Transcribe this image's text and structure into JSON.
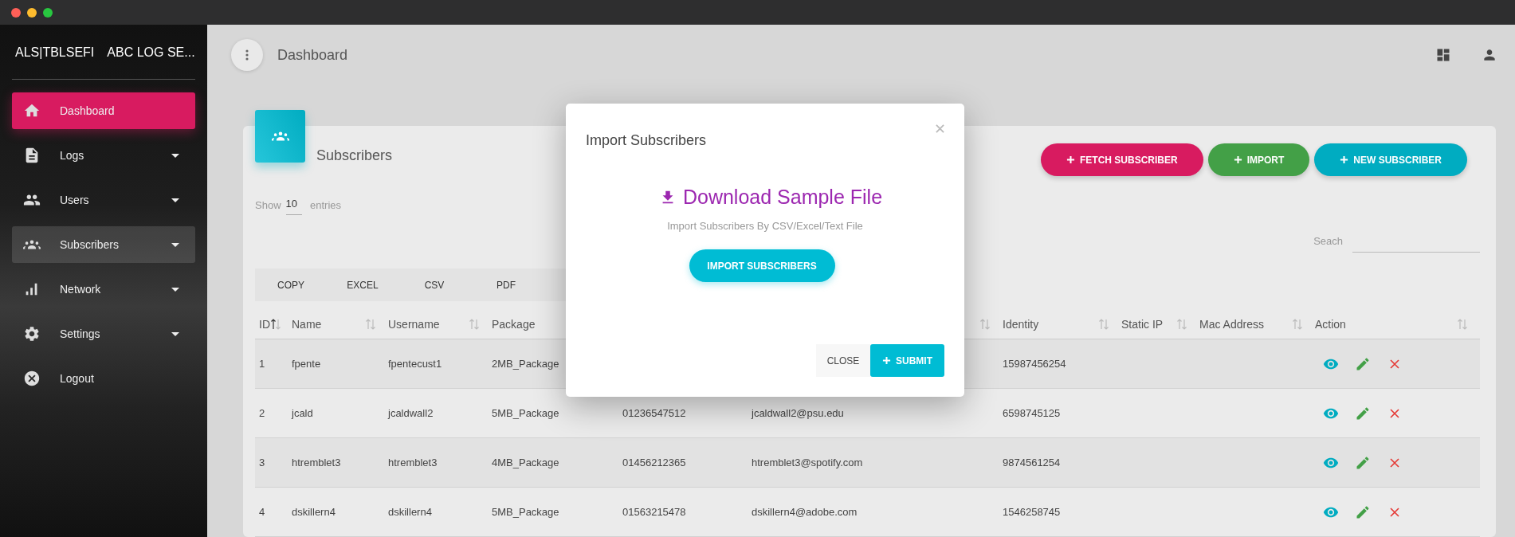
{
  "sidebar": {
    "brand_short": "ALS|TBLSEFI",
    "brand_full": "ABC LOG SE...",
    "items": [
      {
        "label": "Dashboard",
        "selected": true,
        "highlighted": false,
        "has_submenu": false
      },
      {
        "label": "Logs",
        "selected": false,
        "highlighted": false,
        "has_submenu": true
      },
      {
        "label": "Users",
        "selected": false,
        "highlighted": false,
        "has_submenu": true
      },
      {
        "label": "Subscribers",
        "selected": false,
        "highlighted": true,
        "has_submenu": true
      },
      {
        "label": "Network",
        "selected": false,
        "highlighted": false,
        "has_submenu": true
      },
      {
        "label": "Settings",
        "selected": false,
        "highlighted": false,
        "has_submenu": true
      },
      {
        "label": "Logout",
        "selected": false,
        "highlighted": false,
        "has_submenu": false
      }
    ]
  },
  "header": {
    "title": "Dashboard"
  },
  "card": {
    "title": "Subscribers",
    "actions": [
      {
        "label": "FETCH SUBSCRIBER",
        "color": "#d81b60"
      },
      {
        "label": "IMPORT",
        "color": "#43a047"
      },
      {
        "label": "NEW SUBSCRIBER",
        "color": "#00acc1"
      }
    ],
    "show_entries": {
      "prefix": "Show",
      "value": "10",
      "suffix": "entries"
    },
    "search": {
      "label": "Seach"
    },
    "export_buttons": [
      "COPY",
      "EXCEL",
      "CSV",
      "PDF"
    ],
    "table": {
      "columns": [
        {
          "label": "ID",
          "sorted": true
        },
        {
          "label": "Name",
          "sorted": false
        },
        {
          "label": "Username",
          "sorted": false
        },
        {
          "label": "Package"
        },
        {},
        {
          "sorted": false
        },
        {
          "label": "Identity",
          "sorted": false
        },
        {
          "label": "Static IP",
          "sorted": false
        },
        {
          "label": "Mac Address",
          "sorted": false
        },
        {
          "label": "Action",
          "sorted": false
        }
      ],
      "rows": [
        {
          "id": "1",
          "name": "fpente",
          "username": "fpentecust1",
          "package": "2MB_Package",
          "identity": "15987456254"
        },
        {
          "id": "2",
          "name": "jcald",
          "username": "jcaldwall2",
          "package": "5MB_Package",
          "column_5": "01236547512",
          "column_6": "jcaldwall2@psu.edu",
          "identity": "6598745125"
        },
        {
          "id": "3",
          "name": "htremblet3",
          "username": "htremblet3",
          "package": "4MB_Package",
          "column_5": "01456212365",
          "column_6": "htremblet3@spotify.com",
          "identity": "9874561254"
        },
        {
          "id": "4",
          "name": "dskillern4",
          "username": "dskillern4",
          "package": "5MB_Package",
          "column_5": "01563215478",
          "column_6": "dskillern4@adobe.com",
          "identity": "1546258745"
        }
      ]
    }
  },
  "modal": {
    "title": "Import Subscribers",
    "download_link": "Download Sample File",
    "hint": "Import Subscribers By CSV/Excel/Text File",
    "import_button": "IMPORT SUBSCRIBERS",
    "close_button": "CLOSE",
    "submit_button": "SUBMIT"
  }
}
